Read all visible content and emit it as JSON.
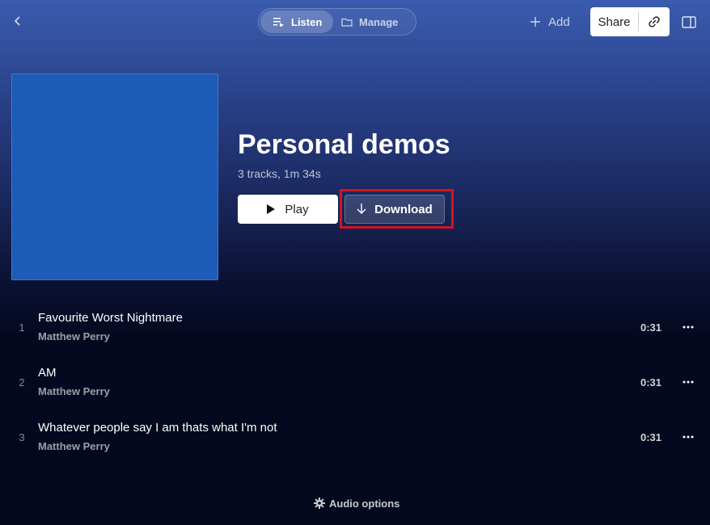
{
  "header": {
    "back_icon": "chevron-left-icon",
    "tabs": [
      {
        "label": "Listen",
        "icon": "playlist-icon",
        "active": true
      },
      {
        "label": "Manage",
        "icon": "folder-icon",
        "active": false
      }
    ],
    "add_label": "Add",
    "share_label": "Share",
    "link_icon": "link-icon",
    "panel_icon": "sidebar-panel-icon"
  },
  "album": {
    "cover_color": "#1c5bb7",
    "title": "Personal demos",
    "meta": "3 tracks, 1m 34s",
    "play_label": "Play",
    "download_label": "Download"
  },
  "tracks": [
    {
      "number": "1",
      "title": "Favourite Worst Nightmare",
      "artist": "Matthew Perry",
      "duration": "0:31"
    },
    {
      "number": "2",
      "title": "AM",
      "artist": "Matthew Perry",
      "duration": "0:31"
    },
    {
      "number": "3",
      "title": "Whatever people say I am thats what I'm not",
      "artist": "Matthew Perry",
      "duration": "0:31"
    }
  ],
  "footer": {
    "audio_options_label": "Audio options",
    "audio_options_icon": "gear-icon"
  },
  "colors": {
    "highlight": "#d2161e",
    "background": "#04081c",
    "gradient_top": "#3a5cae"
  }
}
